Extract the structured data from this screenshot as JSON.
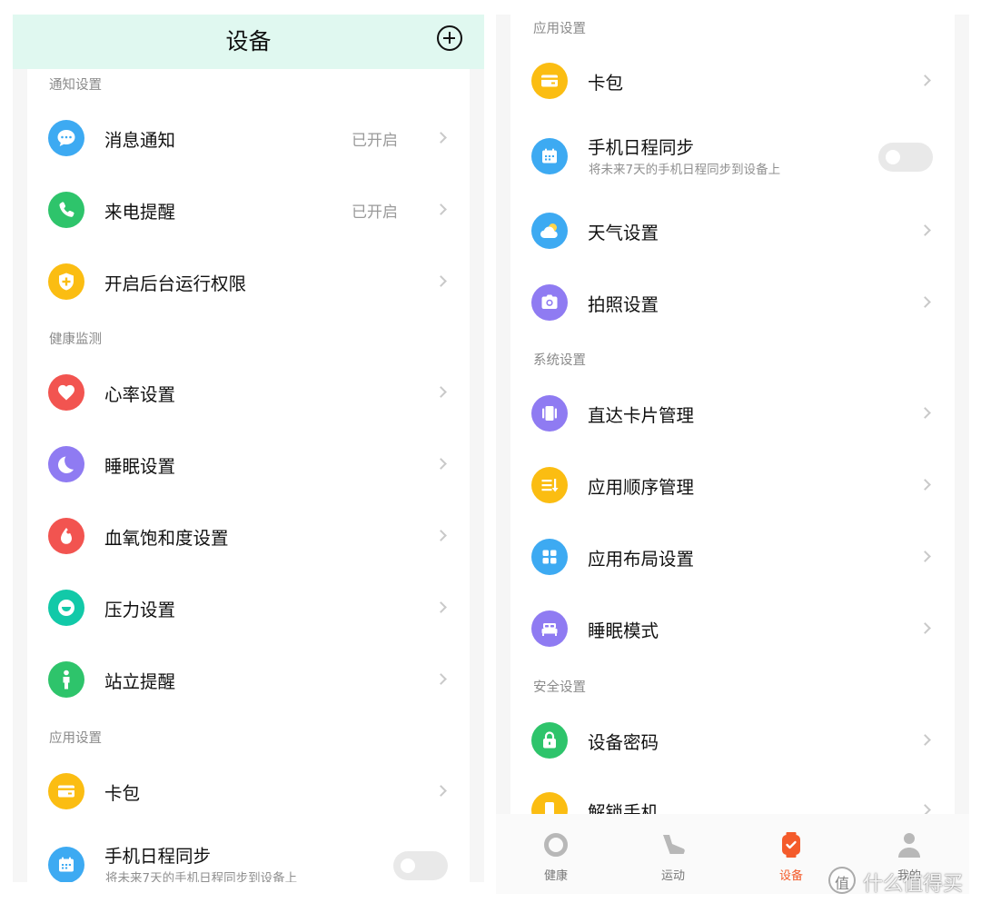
{
  "left_screen": {
    "title": "设备",
    "sections": {
      "notify": "通知设置",
      "health": "健康监测",
      "apps": "应用设置"
    },
    "items": {
      "message": {
        "label": "消息通知",
        "status": "已开启"
      },
      "call": {
        "label": "来电提醒",
        "status": "已开启"
      },
      "background": {
        "label": "开启后台运行权限"
      },
      "heart": {
        "label": "心率设置"
      },
      "sleep": {
        "label": "睡眠设置"
      },
      "spo2": {
        "label": "血氧饱和度设置"
      },
      "stress": {
        "label": "压力设置"
      },
      "stand": {
        "label": "站立提醒"
      },
      "wallet": {
        "label": "卡包"
      },
      "calendar": {
        "label": "手机日程同步",
        "sub": "将未来7天的手机日程同步到设备上",
        "toggle_on": false
      }
    }
  },
  "right_screen": {
    "sections": {
      "apps": "应用设置",
      "system": "系统设置",
      "security": "安全设置"
    },
    "items": {
      "wallet": {
        "label": "卡包"
      },
      "calendar": {
        "label": "手机日程同步",
        "sub": "将未来7天的手机日程同步到设备上",
        "toggle_on": false
      },
      "weather": {
        "label": "天气设置"
      },
      "camera": {
        "label": "拍照设置"
      },
      "cards": {
        "label": "直达卡片管理"
      },
      "app_order": {
        "label": "应用顺序管理"
      },
      "app_layout": {
        "label": "应用布局设置"
      },
      "sleep_mode": {
        "label": "睡眠模式"
      },
      "password": {
        "label": "设备密码"
      },
      "unlock": {
        "label": "解锁手机"
      }
    },
    "tabs": {
      "health": "健康",
      "sport": "运动",
      "device": "设备",
      "me": "我的"
    },
    "active_tab": "device"
  },
  "watermark": "什么值得买",
  "colors": {
    "header_bg": "#e0f8f0",
    "accent_active_tab": "#f45b2b",
    "blue": "#3daaf2",
    "green": "#2ec46b",
    "yellow": "#fbbd12",
    "red": "#f25450",
    "purple": "#8f7bf2",
    "teal": "#12c9a8"
  },
  "icons": {
    "message": "chat-bubble-icon",
    "call": "phone-icon",
    "background": "shield-plus-icon",
    "heart": "heart-icon",
    "sleep": "moon-icon",
    "spo2": "drop-icon",
    "stress": "stress-face-icon",
    "stand": "standing-person-icon",
    "wallet": "wallet-card-icon",
    "calendar": "calendar-icon",
    "weather": "cloud-sun-icon",
    "camera": "camera-icon",
    "cards": "cards-icon",
    "app_order": "sort-list-icon",
    "app_layout": "grid-icon",
    "sleep_mode": "bed-icon",
    "password": "lock-icon",
    "unlock": "phone-unlock-icon"
  }
}
